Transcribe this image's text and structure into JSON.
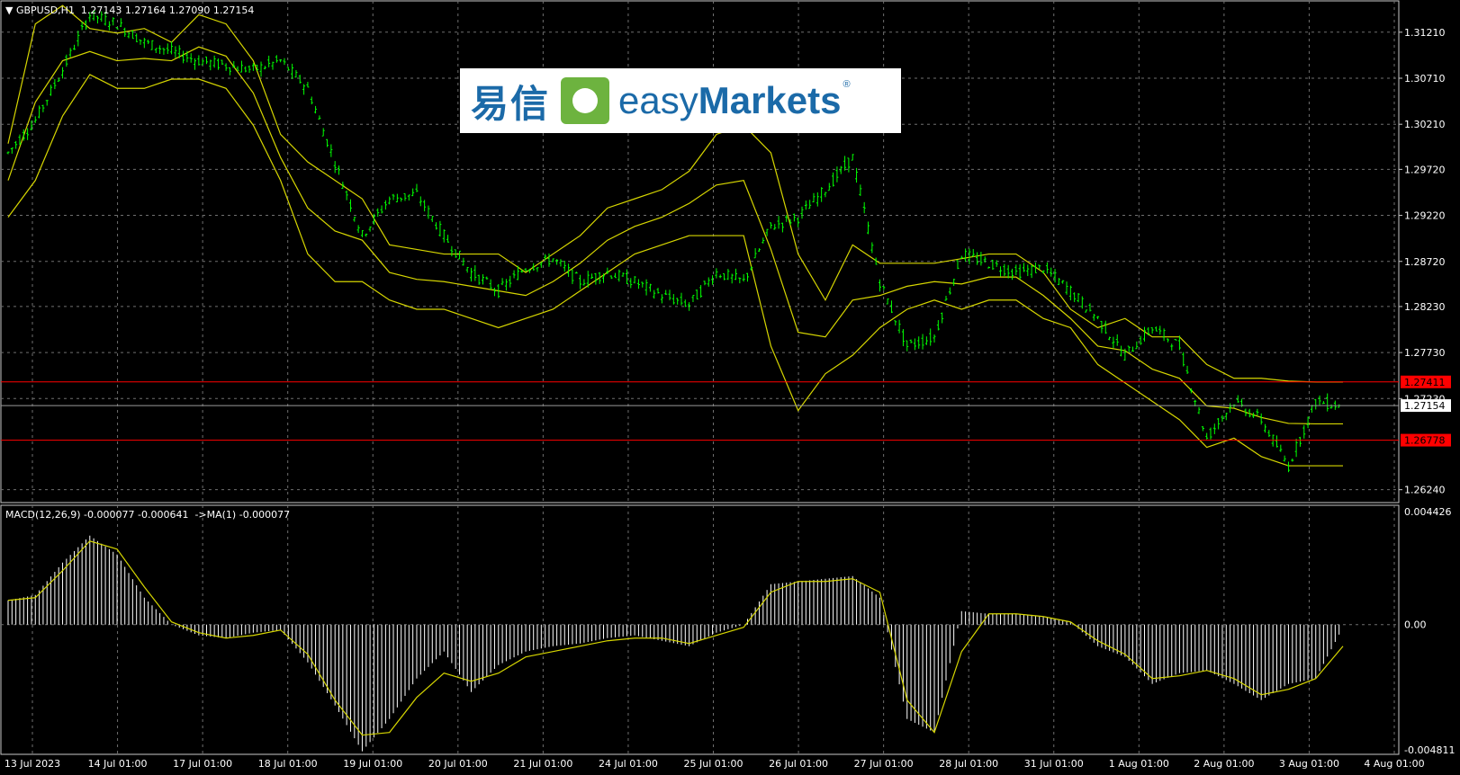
{
  "header": {
    "symbol_info": "GBPUSD,H1  1.27143 1.27164 1.27090 1.27154",
    "macd_info": "MACD(12,26,9) -0.000077 -0.000641  ->MA(1) -0.000077"
  },
  "logo": {
    "cn": "易信",
    "en_light": "easy",
    "en_bold": "Markets",
    "reg": "®"
  },
  "colors": {
    "background": "#000000",
    "grid": "#6f6f6f",
    "candle": "#00ff00",
    "bands": "#d6d600",
    "hline": "#ff0000",
    "histogram": "#ffffff",
    "signal": "#d6d600",
    "axis_text": "#ffffff"
  },
  "chart_data": [
    {
      "type": "candlestick",
      "title": "GBPUSD,H1",
      "ylim": [
        1.261,
        1.3155
      ],
      "ytick_labels": [
        "1.31210",
        "1.30710",
        "1.30210",
        "1.29720",
        "1.29220",
        "1.28720",
        "1.28230",
        "1.27730",
        "1.27230",
        "1.26240"
      ],
      "xtick_labels": [
        "13 Jul 2023",
        "14 Jul 01:00",
        "17 Jul 01:00",
        "18 Jul 01:00",
        "19 Jul 01:00",
        "20 Jul 01:00",
        "21 Jul 01:00",
        "24 Jul 01:00",
        "25 Jul 01:00",
        "26 Jul 01:00",
        "27 Jul 01:00",
        "28 Jul 01:00",
        "31 Jul 01:00",
        "1 Aug 01:00",
        "2 Aug 01:00",
        "3 Aug 01:00",
        "4 Aug 01:00"
      ],
      "price_path": [
        1.299,
        1.3025,
        1.308,
        1.314,
        1.313,
        1.311,
        1.31,
        1.309,
        1.3085,
        1.308,
        1.309,
        1.306,
        1.298,
        1.29,
        1.294,
        1.2945,
        1.29,
        1.286,
        1.284,
        1.2865,
        1.2875,
        1.285,
        1.286,
        1.285,
        1.2835,
        1.2825,
        1.286,
        1.285,
        1.291,
        1.292,
        1.295,
        1.2985,
        1.285,
        1.278,
        1.279,
        1.288,
        1.287,
        1.286,
        1.2865,
        1.284,
        1.281,
        1.277,
        1.28,
        1.278,
        1.268,
        1.272,
        1.27,
        1.265,
        1.272,
        1.2715
      ],
      "upper_band": [
        1.3,
        1.313,
        1.315,
        1.3125,
        1.312,
        1.3125,
        1.311,
        1.314,
        1.313,
        1.309,
        1.301,
        1.298,
        1.296,
        1.294,
        1.289,
        1.2885,
        1.288,
        1.288,
        1.288,
        1.286,
        1.288,
        1.29,
        1.293,
        1.294,
        1.295,
        1.297,
        1.301,
        1.302,
        1.299,
        1.288,
        1.283,
        1.289,
        1.287,
        1.287,
        1.287,
        1.2875,
        1.288,
        1.288,
        1.286,
        1.282,
        1.28,
        1.281,
        1.279,
        1.279,
        1.276,
        1.2745,
        1.2745,
        1.2742,
        1.2741,
        1.2741
      ],
      "lower_band": [
        1.292,
        1.296,
        1.303,
        1.3075,
        1.306,
        1.306,
        1.307,
        1.307,
        1.306,
        1.302,
        1.296,
        1.288,
        1.285,
        1.285,
        1.283,
        1.282,
        1.282,
        1.281,
        1.28,
        1.281,
        1.282,
        1.284,
        1.286,
        1.288,
        1.289,
        1.29,
        1.29,
        1.29,
        1.278,
        1.271,
        1.275,
        1.277,
        1.28,
        1.282,
        1.283,
        1.282,
        1.283,
        1.283,
        1.281,
        1.28,
        1.276,
        1.274,
        1.272,
        1.27,
        1.267,
        1.268,
        1.266,
        1.265,
        1.265,
        1.265
      ],
      "horizontal_lines": [
        {
          "value": 1.27411,
          "label": "1.27411",
          "color": "#ff0000"
        },
        {
          "value": 1.26778,
          "label": "1.26778",
          "color": "#ff0000"
        }
      ],
      "current_price": {
        "value": 1.27154,
        "label": "1.27154"
      },
      "grid": true
    },
    {
      "type": "bar",
      "title": "MACD(12,26,9)",
      "ylim": [
        -0.004811,
        0.004426
      ],
      "ytick_labels": [
        "0.004426",
        "0.00",
        "-0.004811"
      ],
      "histogram": [
        0.0009,
        0.0011,
        0.0023,
        0.0033,
        0.0026,
        0.001,
        0.0,
        -0.0004,
        -0.0005,
        -0.0003,
        -0.0002,
        -0.0014,
        -0.003,
        -0.0047,
        -0.0035,
        -0.002,
        -0.001,
        -0.0025,
        -0.0015,
        -0.001,
        -0.0008,
        -0.0007,
        -0.0005,
        -0.0004,
        -0.0006,
        -0.0008,
        -0.0003,
        0.0,
        0.0015,
        0.0016,
        0.0017,
        0.0018,
        0.001,
        -0.0035,
        -0.004,
        0.0005,
        0.0004,
        0.0004,
        0.0003,
        0.0001,
        -0.0008,
        -0.0012,
        -0.0022,
        -0.0018,
        -0.0017,
        -0.0022,
        -0.0028,
        -0.0022,
        -0.002,
        -0.0001
      ],
      "signal": [
        0.0009,
        0.001,
        0.002,
        0.0031,
        0.0028,
        0.0014,
        0.0001,
        -0.0003,
        -0.0005,
        -0.0004,
        -0.0002,
        -0.0011,
        -0.0028,
        -0.0041,
        -0.004,
        -0.0027,
        -0.0018,
        -0.0021,
        -0.0018,
        -0.0012,
        -0.001,
        -0.0008,
        -0.0006,
        -0.0005,
        -0.0005,
        -0.0007,
        -0.0004,
        -0.0001,
        0.0012,
        0.0016,
        0.0016,
        0.0017,
        0.0012,
        -0.0028,
        -0.004,
        -0.001,
        0.0004,
        0.0004,
        0.0003,
        0.0001,
        -0.0006,
        -0.0011,
        -0.002,
        -0.0019,
        -0.0017,
        -0.002,
        -0.0026,
        -0.0024,
        -0.002,
        -0.0008
      ],
      "grid": true
    }
  ]
}
